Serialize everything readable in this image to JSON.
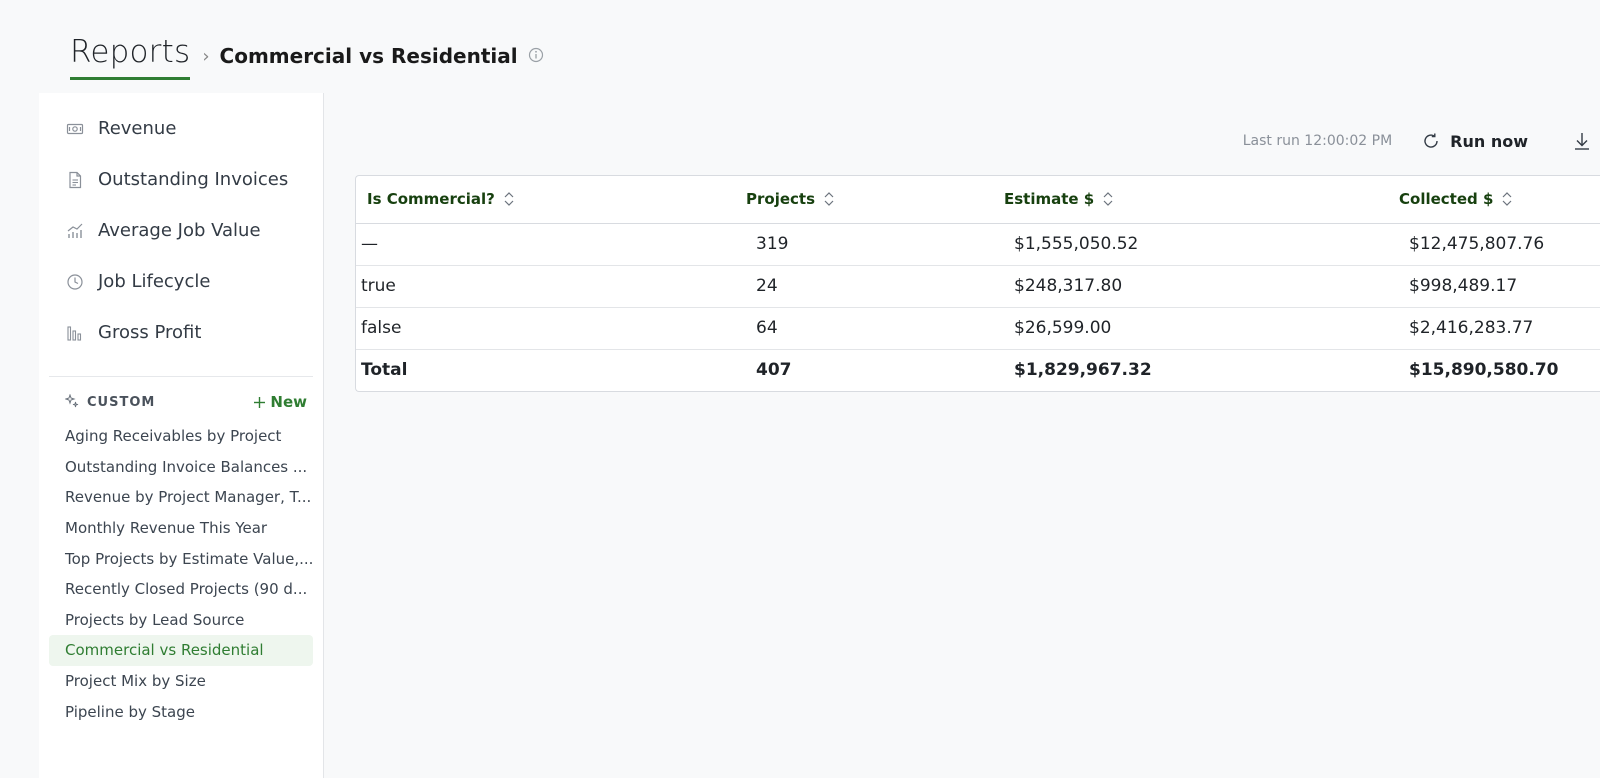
{
  "header": {
    "title": "Reports",
    "separator": "›",
    "breadcrumb": "Commercial vs Residential"
  },
  "sidebar": {
    "nav": [
      {
        "label": "Revenue",
        "icon": "money-icon"
      },
      {
        "label": "Outstanding Invoices",
        "icon": "document-icon"
      },
      {
        "label": "Average Job Value",
        "icon": "trend-chart-icon"
      },
      {
        "label": "Job Lifecycle",
        "icon": "clock-icon"
      },
      {
        "label": "Gross Profit",
        "icon": "bar-chart-icon"
      }
    ],
    "custom_label": "CUSTOM",
    "new_label": "New",
    "custom_items": [
      "Aging Receivables by Project",
      "Outstanding Invoice Balances ...",
      "Revenue by Project Manager, T...",
      "Monthly Revenue This Year",
      "Top Projects by Estimate Value,...",
      "Recently Closed Projects (90 d...",
      "Projects by Lead Source",
      "Commercial vs Residential",
      "Project Mix by Size",
      "Pipeline by Stage"
    ],
    "active_item": "Commercial vs Residential"
  },
  "toolbar": {
    "last_run": "Last run 12:00:02 PM",
    "run_now": "Run now"
  },
  "table": {
    "columns": [
      "Is Commercial?",
      "Projects",
      "Estimate $",
      "Collected $"
    ],
    "rows": [
      [
        "—",
        "319",
        "$1,555,050.52",
        "$12,475,807.76"
      ],
      [
        "true",
        "24",
        "$248,317.80",
        "$998,489.17"
      ],
      [
        "false",
        "64",
        "$26,599.00",
        "$2,416,283.77"
      ]
    ],
    "total": [
      "Total",
      "407",
      "$1,829,967.32",
      "$15,890,580.70"
    ]
  },
  "colors": {
    "accent": "#2f7d32",
    "header_text": "#17400f",
    "active_bg": "#eef6ee"
  }
}
